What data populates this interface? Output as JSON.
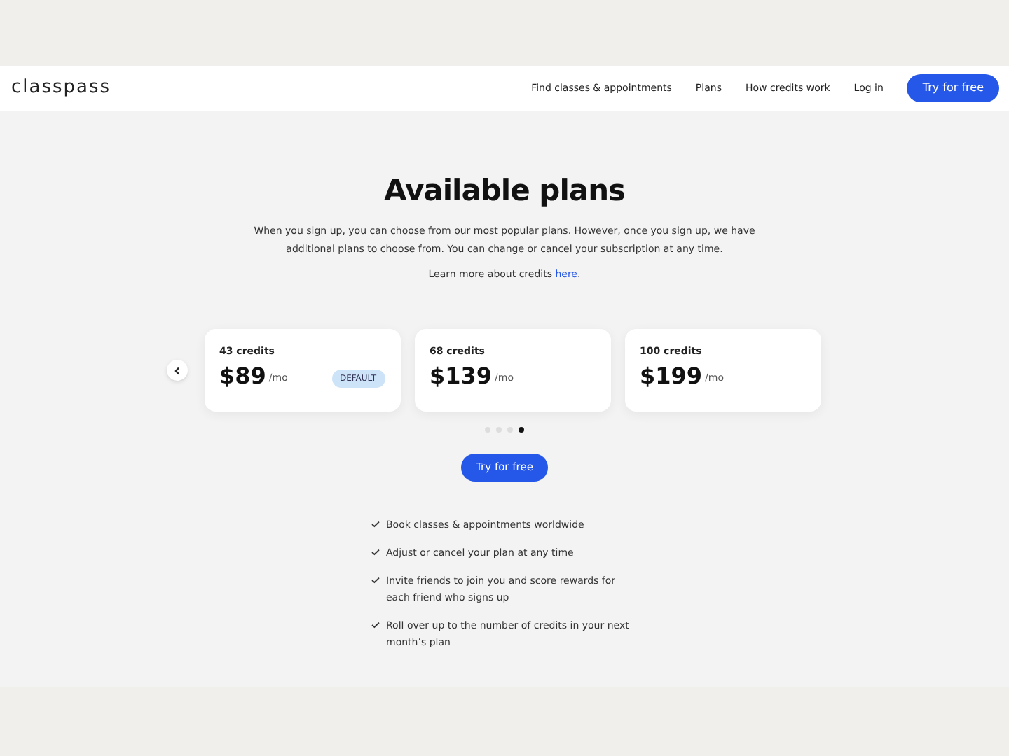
{
  "nav": {
    "logo": "classpass",
    "links": [
      "Find classes & appointments",
      "Plans",
      "How credits work",
      "Log in"
    ],
    "cta": "Try for free"
  },
  "heading": "Available plans",
  "intro": "When you sign up, you can choose from our most popular plans. However, once you sign up, we have additional plans to choose from. You can change or cancel your subscription at any time.",
  "learn_more": {
    "text": "Learn more about credits ",
    "link": "here",
    "after": "."
  },
  "plans": [
    {
      "credits": "43 credits",
      "price": "$89",
      "period": "/mo",
      "badge": "DEFAULT"
    },
    {
      "credits": "68 credits",
      "price": "$139",
      "period": "/mo"
    },
    {
      "credits": "100 credits",
      "price": "$199",
      "period": "/mo"
    }
  ],
  "dots": [
    {
      "selected": false
    },
    {
      "selected": false
    },
    {
      "selected": false
    },
    {
      "selected": true
    }
  ],
  "cta": "Try for free",
  "features": [
    "Book classes & appointments worldwide",
    "Adjust or cancel your plan at any time",
    "Invite friends to join you and score rewards for each friend who signs up",
    "Roll over up to the number of credits in your next month’s plan"
  ]
}
